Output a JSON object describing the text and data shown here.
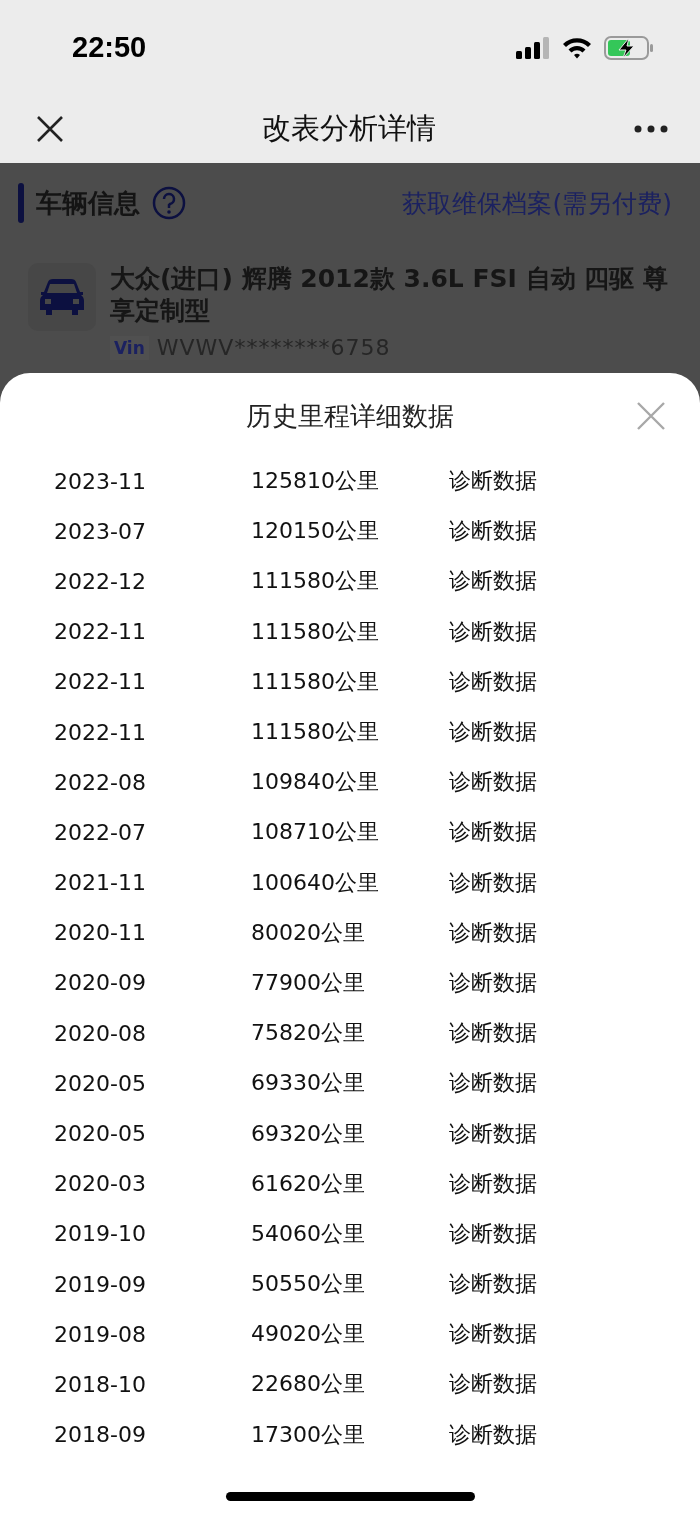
{
  "status_bar": {
    "time": "22:50"
  },
  "nav": {
    "title": "改表分析详情"
  },
  "vehicle_section": {
    "title": "车辆信息",
    "link": "获取维保档案(需另付费)",
    "model": "大众(进口) 辉腾 2012款 3.6L FSI 自动 四驱 尊享定制型",
    "vin_label": "Vin",
    "vin": "WVWV********6758"
  },
  "sheet": {
    "title": "历史里程详细数据",
    "rows": [
      {
        "date": "2023-11",
        "mileage": "125810公里",
        "action": "诊断数据"
      },
      {
        "date": "2023-07",
        "mileage": "120150公里",
        "action": "诊断数据"
      },
      {
        "date": "2022-12",
        "mileage": "111580公里",
        "action": "诊断数据"
      },
      {
        "date": "2022-11",
        "mileage": "111580公里",
        "action": "诊断数据"
      },
      {
        "date": "2022-11",
        "mileage": "111580公里",
        "action": "诊断数据"
      },
      {
        "date": "2022-11",
        "mileage": "111580公里",
        "action": "诊断数据"
      },
      {
        "date": "2022-08",
        "mileage": "109840公里",
        "action": "诊断数据"
      },
      {
        "date": "2022-07",
        "mileage": "108710公里",
        "action": "诊断数据"
      },
      {
        "date": "2021-11",
        "mileage": "100640公里",
        "action": "诊断数据"
      },
      {
        "date": "2020-11",
        "mileage": "80020公里",
        "action": "诊断数据"
      },
      {
        "date": "2020-09",
        "mileage": "77900公里",
        "action": "诊断数据"
      },
      {
        "date": "2020-08",
        "mileage": "75820公里",
        "action": "诊断数据"
      },
      {
        "date": "2020-05",
        "mileage": "69330公里",
        "action": "诊断数据"
      },
      {
        "date": "2020-05",
        "mileage": "69320公里",
        "action": "诊断数据"
      },
      {
        "date": "2020-03",
        "mileage": "61620公里",
        "action": "诊断数据"
      },
      {
        "date": "2019-10",
        "mileage": "54060公里",
        "action": "诊断数据"
      },
      {
        "date": "2019-09",
        "mileage": "50550公里",
        "action": "诊断数据"
      },
      {
        "date": "2019-08",
        "mileage": "49020公里",
        "action": "诊断数据"
      },
      {
        "date": "2018-10",
        "mileage": "22680公里",
        "action": "诊断数据"
      },
      {
        "date": "2018-09",
        "mileage": "17300公里",
        "action": "诊断数据"
      }
    ]
  }
}
